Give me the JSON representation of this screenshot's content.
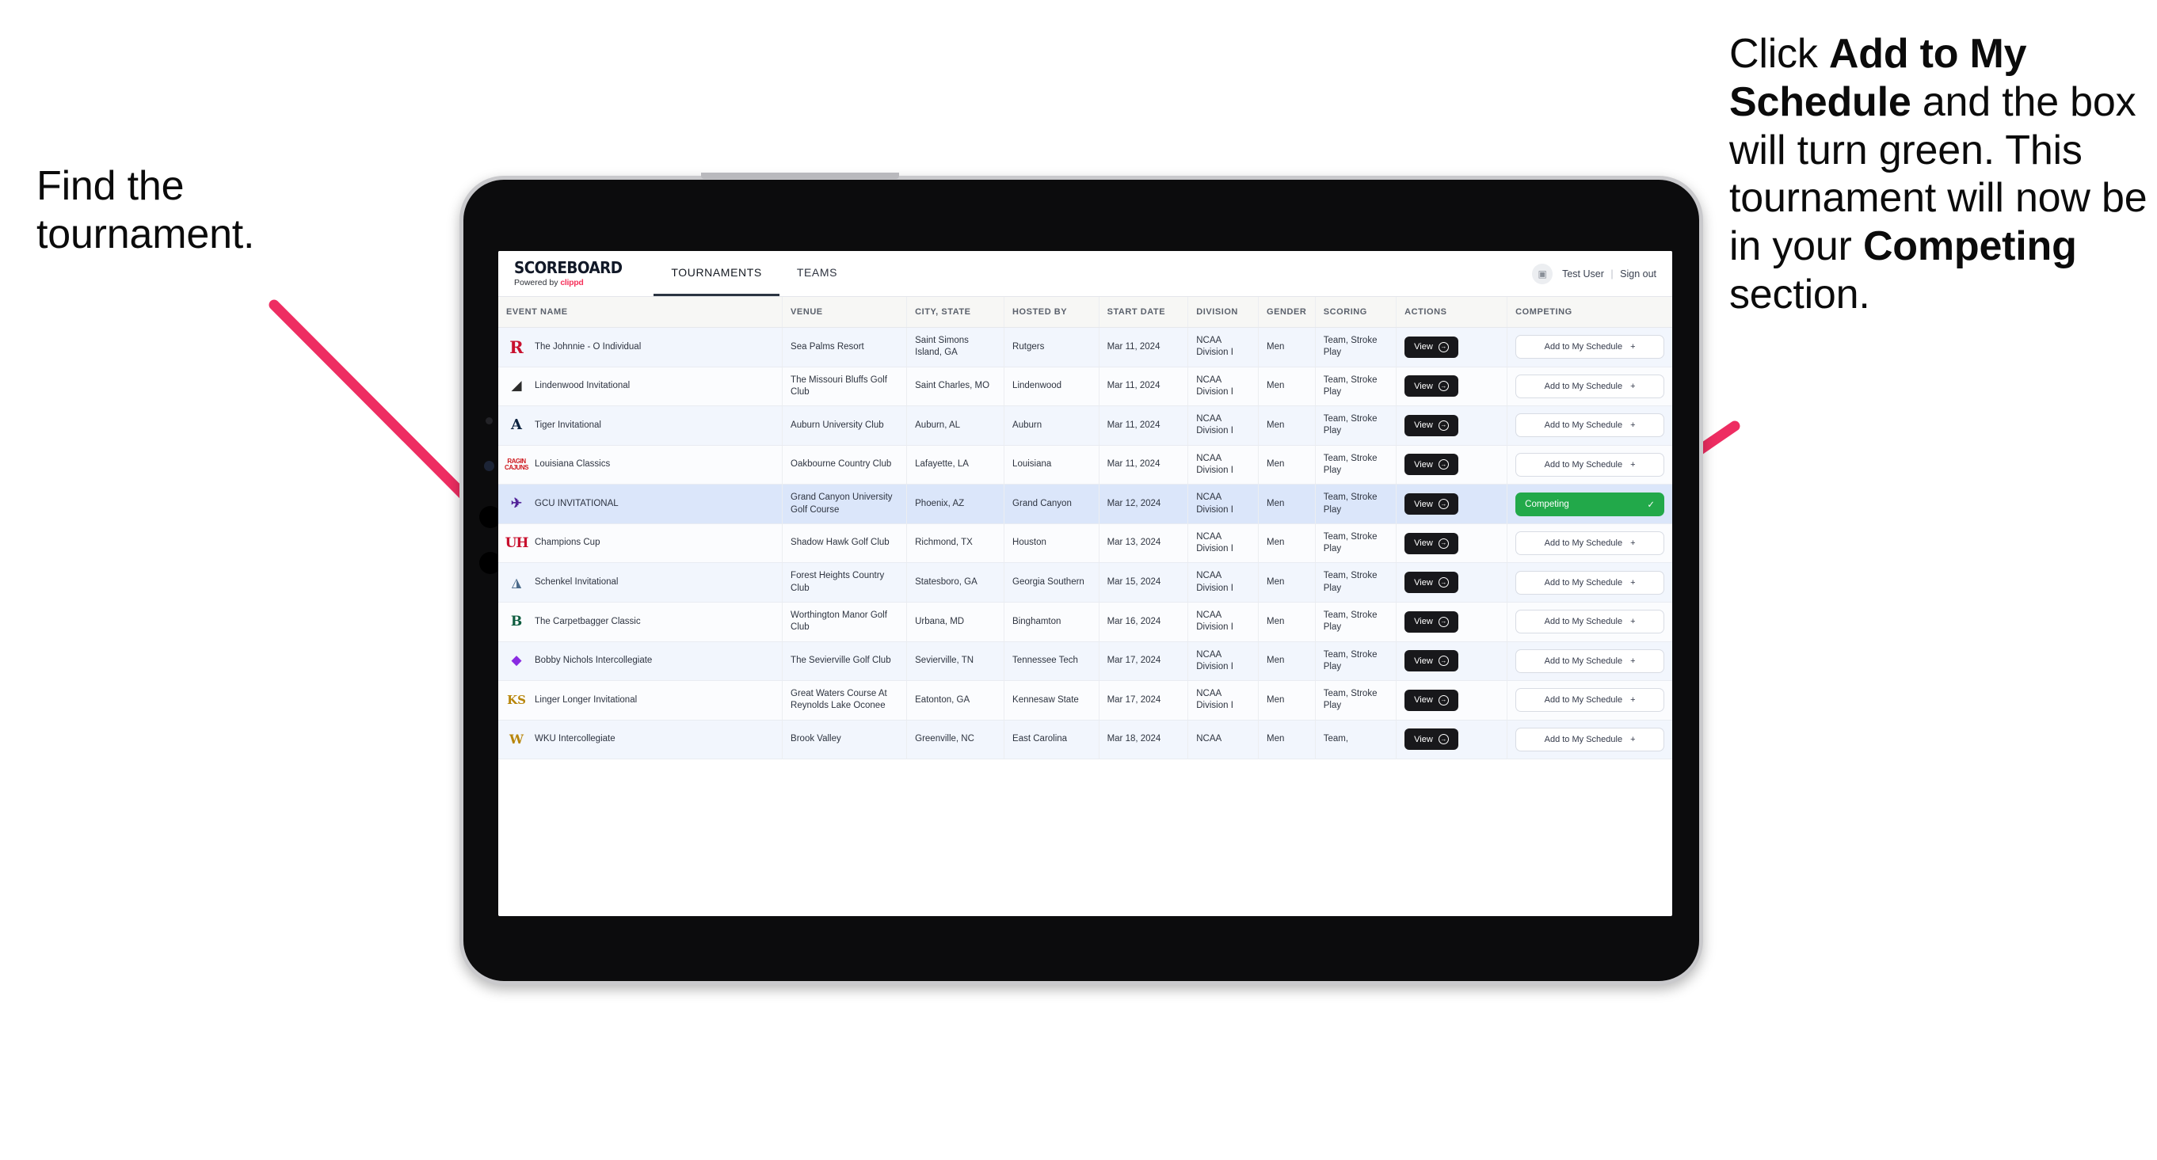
{
  "annotations": {
    "left": "Find the tournament.",
    "right_parts": [
      {
        "text": "Click ",
        "bold": false
      },
      {
        "text": "Add to My Schedule",
        "bold": true
      },
      {
        "text": " and the box will turn green. This tournament will now be in your ",
        "bold": false
      },
      {
        "text": "Competing",
        "bold": true
      },
      {
        "text": " section.",
        "bold": false
      }
    ],
    "arrow_color": "#ee2d62"
  },
  "app": {
    "brand": {
      "title": "SCOREBOARD",
      "powered_prefix": "Powered by ",
      "powered_brand": "clippd"
    },
    "tabs": [
      {
        "label": "TOURNAMENTS",
        "active": true
      },
      {
        "label": "TEAMS",
        "active": false
      }
    ],
    "user": {
      "avatar_icon": "user-avatar-icon",
      "name": "Test User",
      "separator": "|",
      "sign_out": "Sign out"
    },
    "table": {
      "columns": [
        "EVENT NAME",
        "VENUE",
        "CITY, STATE",
        "HOSTED BY",
        "START DATE",
        "DIVISION",
        "GENDER",
        "SCORING",
        "ACTIONS",
        "COMPETING"
      ],
      "action_label": "View",
      "add_label": "Add to My Schedule",
      "add_icon": "plus-icon",
      "competing_label": "Competing",
      "competing_icon": "check-icon",
      "competing_color": "#22a94a",
      "rows": [
        {
          "logo": "R",
          "logo_class": "rutgers",
          "event": "The Johnnie - O Individual",
          "venue": "Sea Palms Resort",
          "city": "Saint Simons Island, GA",
          "host": "Rutgers",
          "date": "Mar 11, 2024",
          "division": "NCAA Division I",
          "gender": "Men",
          "scoring": "Team, Stroke Play",
          "competing": false
        },
        {
          "logo": "◢",
          "logo_class": "lindenwood",
          "event": "Lindenwood Invitational",
          "venue": "The Missouri Bluffs Golf Club",
          "city": "Saint Charles, MO",
          "host": "Lindenwood",
          "date": "Mar 11, 2024",
          "division": "NCAA Division I",
          "gender": "Men",
          "scoring": "Team, Stroke Play",
          "competing": false
        },
        {
          "logo": "A",
          "logo_class": "auburn",
          "event": "Tiger Invitational",
          "venue": "Auburn University Club",
          "city": "Auburn, AL",
          "host": "Auburn",
          "date": "Mar 11, 2024",
          "division": "NCAA Division I",
          "gender": "Men",
          "scoring": "Team, Stroke Play",
          "competing": false
        },
        {
          "logo": "RAGIN CAJUNS",
          "logo_class": "louisiana",
          "event": "Louisiana Classics",
          "venue": "Oakbourne Country Club",
          "city": "Lafayette, LA",
          "host": "Louisiana",
          "date": "Mar 11, 2024",
          "division": "NCAA Division I",
          "gender": "Men",
          "scoring": "Team, Stroke Play",
          "competing": false
        },
        {
          "logo": "✈",
          "logo_class": "gcu",
          "event": "GCU INVITATIONAL",
          "venue": "Grand Canyon University Golf Course",
          "city": "Phoenix, AZ",
          "host": "Grand Canyon",
          "date": "Mar 12, 2024",
          "division": "NCAA Division I",
          "gender": "Men",
          "scoring": "Team, Stroke Play",
          "competing": true,
          "selected": true
        },
        {
          "logo": "UH",
          "logo_class": "houston",
          "event": "Champions Cup",
          "venue": "Shadow Hawk Golf Club",
          "city": "Richmond, TX",
          "host": "Houston",
          "date": "Mar 13, 2024",
          "division": "NCAA Division I",
          "gender": "Men",
          "scoring": "Team, Stroke Play",
          "competing": false
        },
        {
          "logo": "◮",
          "logo_class": "gsouthern",
          "event": "Schenkel Invitational",
          "venue": "Forest Heights Country Club",
          "city": "Statesboro, GA",
          "host": "Georgia Southern",
          "date": "Mar 15, 2024",
          "division": "NCAA Division I",
          "gender": "Men",
          "scoring": "Team, Stroke Play",
          "competing": false
        },
        {
          "logo": "B",
          "logo_class": "binghamton",
          "event": "The Carpetbagger Classic",
          "venue": "Worthington Manor Golf Club",
          "city": "Urbana, MD",
          "host": "Binghamton",
          "date": "Mar 16, 2024",
          "division": "NCAA Division I",
          "gender": "Men",
          "scoring": "Team, Stroke Play",
          "competing": false
        },
        {
          "logo": "◆",
          "logo_class": "tntech",
          "event": "Bobby Nichols Intercollegiate",
          "venue": "The Sevierville Golf Club",
          "city": "Sevierville, TN",
          "host": "Tennessee Tech",
          "date": "Mar 17, 2024",
          "division": "NCAA Division I",
          "gender": "Men",
          "scoring": "Team, Stroke Play",
          "competing": false
        },
        {
          "logo": "KS",
          "logo_class": "kennesaw",
          "event": "Linger Longer Invitational",
          "venue": "Great Waters Course At Reynolds Lake Oconee",
          "city": "Eatonton, GA",
          "host": "Kennesaw State",
          "date": "Mar 17, 2024",
          "division": "NCAA Division I",
          "gender": "Men",
          "scoring": "Team, Stroke Play",
          "competing": false
        }
      ],
      "partial_row": {
        "logo": "W",
        "logo_class": "wku",
        "event": "WKU Intercollegiate",
        "venue": "Brook Valley",
        "city": "Greenville, NC",
        "host": "East Carolina",
        "date": "Mar 18, 2024",
        "division": "NCAA",
        "gender": "Men",
        "scoring": "Team,"
      }
    }
  }
}
